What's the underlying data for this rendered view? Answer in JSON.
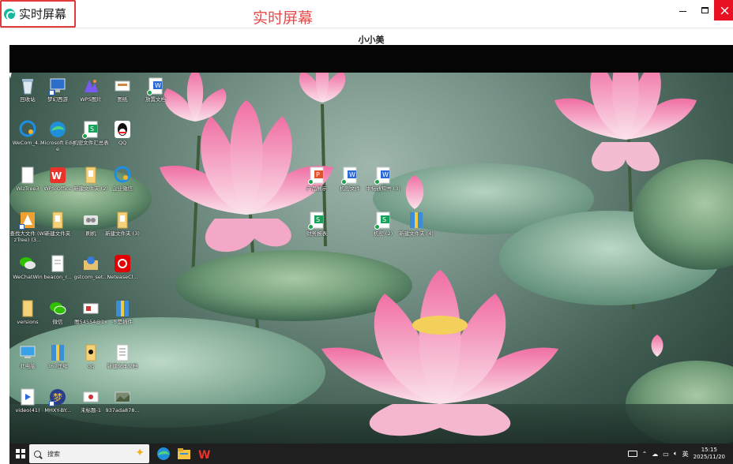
{
  "window": {
    "title": "实时屏幕",
    "annotation": "实时屏幕",
    "viewer_name": "小小美",
    "close_color": "#e81123",
    "annotation_color": "#e84a4a"
  },
  "desktop": {
    "icons": [
      {
        "label": "回收站",
        "icon": "recycle-bin-icon"
      },
      {
        "label": "梦幻西游",
        "icon": "game-icon"
      },
      {
        "label": "WPS图片",
        "icon": "wps-image-icon"
      },
      {
        "label": "图纸",
        "icon": "drawing-icon"
      },
      {
        "label": "放置文档",
        "icon": "word-doc-icon"
      },
      {
        "label": "WeCom_4...",
        "icon": "wecom-icon"
      },
      {
        "label": "Microsoft Edge",
        "icon": "edge-icon"
      },
      {
        "label": "机密文件汇总表",
        "icon": "spreadsheet-icon"
      },
      {
        "label": "QQ",
        "icon": "qq-icon"
      },
      {
        "label": "WizTree3",
        "icon": "file-icon"
      },
      {
        "label": "WPS Office",
        "icon": "wps-office-icon"
      },
      {
        "label": "新建文件夹 (2)",
        "icon": "folder-icon"
      },
      {
        "label": "企业微信",
        "icon": "wecom-icon"
      },
      {
        "label": "产品展示",
        "icon": "ppt-icon"
      },
      {
        "label": "机密文件",
        "icon": "word-doc-icon"
      },
      {
        "label": "中标通知书 (3)",
        "icon": "word-doc-icon"
      },
      {
        "label": "查找大文件 (WizTree) (3...",
        "icon": "wiztree-icon"
      },
      {
        "label": "新建文件夹",
        "icon": "folder-icon"
      },
      {
        "label": "刷机",
        "icon": "tool-icon"
      },
      {
        "label": "新建文件夹 (3)",
        "icon": "folder-icon"
      },
      {
        "label": "财务报表",
        "icon": "spreadsheet-icon"
      },
      {
        "label": "机密 (2)",
        "icon": "spreadsheet-icon"
      },
      {
        "label": "新建文件夹 (4)",
        "icon": "archive-icon"
      },
      {
        "label": "WeChatWin",
        "icon": "wechat-icon"
      },
      {
        "label": "beacon_r...",
        "icon": "file-icon"
      },
      {
        "label": "gstcom_set...",
        "icon": "installer-icon"
      },
      {
        "label": "NeteaseCl...",
        "icon": "netease-icon"
      },
      {
        "label": "versions",
        "icon": "folder-icon"
      },
      {
        "label": "微信",
        "icon": "wechat-icon"
      },
      {
        "label": "图54554@1x",
        "icon": "image-icon"
      },
      {
        "label": "不是插件",
        "icon": "archive-icon"
      },
      {
        "label": "此电脑",
        "icon": "computer-icon"
      },
      {
        "label": "360压缩",
        "icon": "archive-icon"
      },
      {
        "label": "qq",
        "icon": "folder-icon"
      },
      {
        "label": "新建文本文档",
        "icon": "text-file-icon"
      },
      {
        "label": "video(41)",
        "icon": "video-icon"
      },
      {
        "label": "MHXY-BY...",
        "icon": "game-icon"
      },
      {
        "label": "未标题-1",
        "icon": "image-icon"
      },
      {
        "label": "937ada878...",
        "icon": "image-icon"
      }
    ]
  },
  "taskbar": {
    "search_placeholder": "搜索",
    "ime": "英",
    "time": "15:15",
    "date": "2025/11/20"
  }
}
